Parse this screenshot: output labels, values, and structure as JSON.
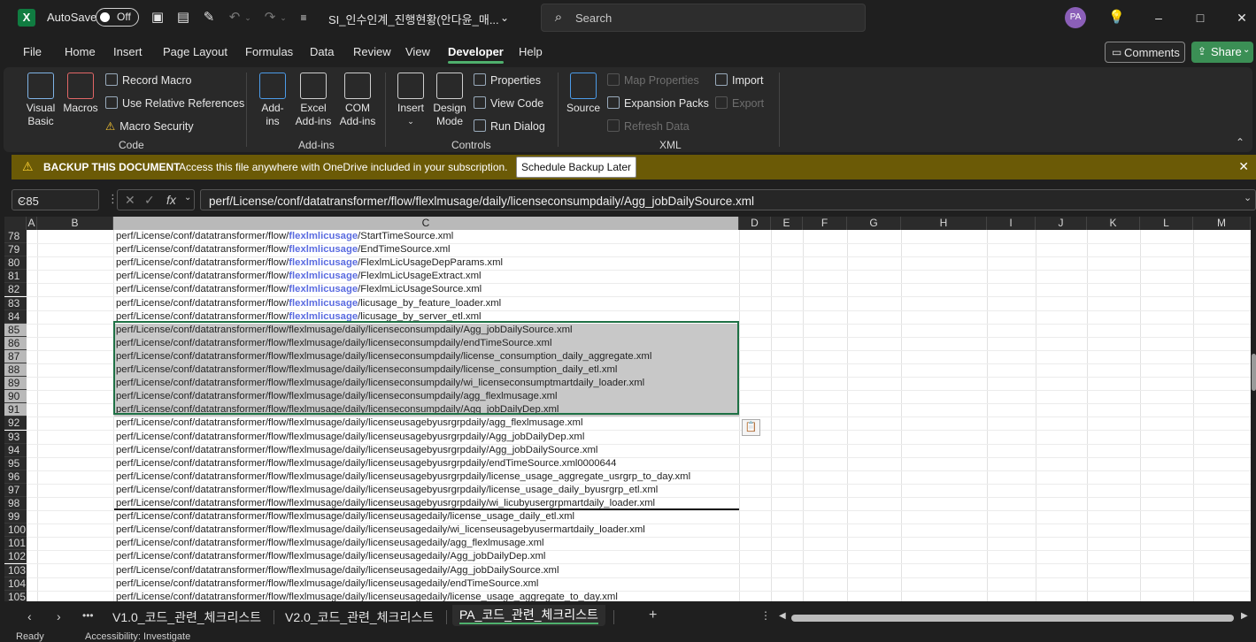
{
  "titlebar": {
    "autosave_label": "AutoSave",
    "autosave_state": "Off",
    "doc_title": "SI_인수인계_진행현황(안다윤_매...",
    "search_placeholder": "Search",
    "avatar": "PA"
  },
  "menu": {
    "tabs": [
      "File",
      "Home",
      "Insert",
      "Page Layout",
      "Formulas",
      "Data",
      "Review",
      "View",
      "Developer",
      "Help"
    ],
    "active": "Developer",
    "comments": "Comments",
    "share": "Share"
  },
  "ribbon": {
    "code": {
      "label": "Code",
      "visual_basic": "Visual\nBasic",
      "visual_basic_1": "Visual",
      "visual_basic_2": "Basic",
      "macros": "Macros",
      "record_macro": "Record Macro",
      "relative_refs": "Use Relative References",
      "macro_security": "Macro Security"
    },
    "addins": {
      "label": "Add-ins",
      "addins_1": "Add-",
      "addins_2": "ins",
      "excel_1": "Excel",
      "excel_2": "Add-ins",
      "com_1": "COM",
      "com_2": "Add-ins"
    },
    "controls": {
      "label": "Controls",
      "insert": "Insert",
      "design_1": "Design",
      "design_2": "Mode",
      "properties": "Properties",
      "view_code": "View Code",
      "run_dialog": "Run Dialog"
    },
    "xml": {
      "label": "XML",
      "source": "Source",
      "map_properties": "Map Properties",
      "expansion_packs": "Expansion Packs",
      "refresh_data": "Refresh Data",
      "import": "Import",
      "export": "Export"
    }
  },
  "notification": {
    "title": "BACKUP THIS DOCUMENT",
    "message": "Access this file anywhere with OneDrive included in your subscription.",
    "button": "Schedule Backup Later"
  },
  "formula_bar": {
    "name_box": "C85",
    "fx": "fx",
    "formula": "perf/License/conf/datatransformer/flow/flexlmusage/daily/licenseconsumpdaily/Agg_jobDailySource.xml"
  },
  "columns": [
    "A",
    "B",
    "C",
    "D",
    "E",
    "F",
    "G",
    "H",
    "I",
    "J",
    "K",
    "L",
    "M"
  ],
  "rows": [
    {
      "n": "78",
      "pre": "perf/License/conf/datatransformer/flow/",
      "hl": "flexlmlicusage",
      "post": "/StartTimeSource.xml"
    },
    {
      "n": "79",
      "pre": "perf/License/conf/datatransformer/flow/",
      "hl": "flexlmlicusage",
      "post": "/EndTimeSource.xml"
    },
    {
      "n": "80",
      "pre": "perf/License/conf/datatransformer/flow/",
      "hl": "flexlmlicusage",
      "post": "/FlexlmLicUsageDepParams.xml"
    },
    {
      "n": "81",
      "pre": "perf/License/conf/datatransformer/flow/",
      "hl": "flexlmlicusage",
      "post": "/FlexlmLicUsageExtract.xml"
    },
    {
      "n": "82",
      "pre": "perf/License/conf/datatransformer/flow/",
      "hl": "flexlmlicusage",
      "post": "/FlexlmLicUsageSource.xml"
    },
    {
      "n": "83",
      "pre": "perf/License/conf/datatransformer/flow/",
      "hl": "flexlmlicusage",
      "post": "/licusage_by_feature_loader.xml"
    },
    {
      "n": "84",
      "pre": "perf/License/conf/datatransformer/flow/",
      "hl": "flexlmlicusage",
      "post": "/licusage_by_server_etl.xml"
    },
    {
      "n": "85",
      "text": "perf/License/conf/datatransformer/flow/flexlmusage/daily/licenseconsumpdaily/Agg_jobDailySource.xml",
      "sel": true
    },
    {
      "n": "86",
      "text": "perf/License/conf/datatransformer/flow/flexlmusage/daily/licenseconsumpdaily/endTimeSource.xml",
      "sel": true
    },
    {
      "n": "87",
      "text": "perf/License/conf/datatransformer/flow/flexlmusage/daily/licenseconsumpdaily/license_consumption_daily_aggregate.xml",
      "sel": true
    },
    {
      "n": "88",
      "text": "perf/License/conf/datatransformer/flow/flexlmusage/daily/licenseconsumpdaily/license_consumption_daily_etl.xml",
      "sel": true
    },
    {
      "n": "89",
      "text": "perf/License/conf/datatransformer/flow/flexlmusage/daily/licenseconsumpdaily/wi_licenseconsumptmartdaily_loader.xml",
      "sel": true
    },
    {
      "n": "90",
      "text": "perf/License/conf/datatransformer/flow/flexlmusage/daily/licenseconsumpdaily/agg_flexlmusage.xml",
      "sel": true
    },
    {
      "n": "91",
      "text": "perf/License/conf/datatransformer/flow/flexlmusage/daily/licenseconsumpdaily/Agg_jobDailyDep.xml",
      "sel": true
    },
    {
      "n": "92",
      "text": "perf/License/conf/datatransformer/flow/flexlmusage/daily/licenseusagebyusrgrpdaily/agg_flexlmusage.xml"
    },
    {
      "n": "93",
      "text": "perf/License/conf/datatransformer/flow/flexlmusage/daily/licenseusagebyusrgrpdaily/Agg_jobDailyDep.xml"
    },
    {
      "n": "94",
      "text": "perf/License/conf/datatransformer/flow/flexlmusage/daily/licenseusagebyusrgrpdaily/Agg_jobDailySource.xml"
    },
    {
      "n": "95",
      "text": "perf/License/conf/datatransformer/flow/flexlmusage/daily/licenseusagebyusrgrpdaily/endTimeSource.xml0000644"
    },
    {
      "n": "96",
      "text": "perf/License/conf/datatransformer/flow/flexlmusage/daily/licenseusagebyusrgrpdaily/license_usage_aggregate_usrgrp_to_day.xml"
    },
    {
      "n": "97",
      "text": "perf/License/conf/datatransformer/flow/flexlmusage/daily/licenseusagebyusrgrpdaily/license_usage_daily_byusrgrp_etl.xml"
    },
    {
      "n": "98",
      "text": "perf/License/conf/datatransformer/flow/flexlmusage/daily/licenseusagebyusrgrpdaily/wi_licubyusergrpmartdaily_loader.xml",
      "border_bottom": true
    },
    {
      "n": "99",
      "text": "perf/License/conf/datatransformer/flow/flexlmusage/daily/licenseusagedaily/license_usage_daily_etl.xml"
    },
    {
      "n": "100",
      "text": "perf/License/conf/datatransformer/flow/flexlmusage/daily/licenseusagedaily/wi_licenseusagebyusermartdaily_loader.xml"
    },
    {
      "n": "101",
      "text": "perf/License/conf/datatransformer/flow/flexlmusage/daily/licenseusagedaily/agg_flexlmusage.xml"
    },
    {
      "n": "102",
      "text": "perf/License/conf/datatransformer/flow/flexlmusage/daily/licenseusagedaily/Agg_jobDailyDep.xml"
    },
    {
      "n": "103",
      "text": "perf/License/conf/datatransformer/flow/flexlmusage/daily/licenseusagedaily/Agg_jobDailySource.xml"
    },
    {
      "n": "104",
      "text": "perf/License/conf/datatransformer/flow/flexlmusage/daily/licenseusagedaily/endTimeSource.xml"
    },
    {
      "n": "105",
      "text": "perf/License/conf/datatransformer/flow/flexlmusage/daily/licenseusagedaily/license_usage_aggregate_to_day.xml"
    }
  ],
  "sheets": [
    "V1.0_코드_관련_체크리스트",
    "V2.0_코드_관련_체크리스트",
    "PA_코드_관련_체크리스트"
  ],
  "active_sheet": "PA_코드_관련_체크리스트",
  "status": {
    "ready": "Ready",
    "accessibility": "Accessibility: Investigate"
  },
  "colors": {
    "accent": "#4fb06d",
    "selection_border": "#1e7145",
    "highlight_text": "#5a6be0",
    "notification_bg": "#6b5a06"
  }
}
